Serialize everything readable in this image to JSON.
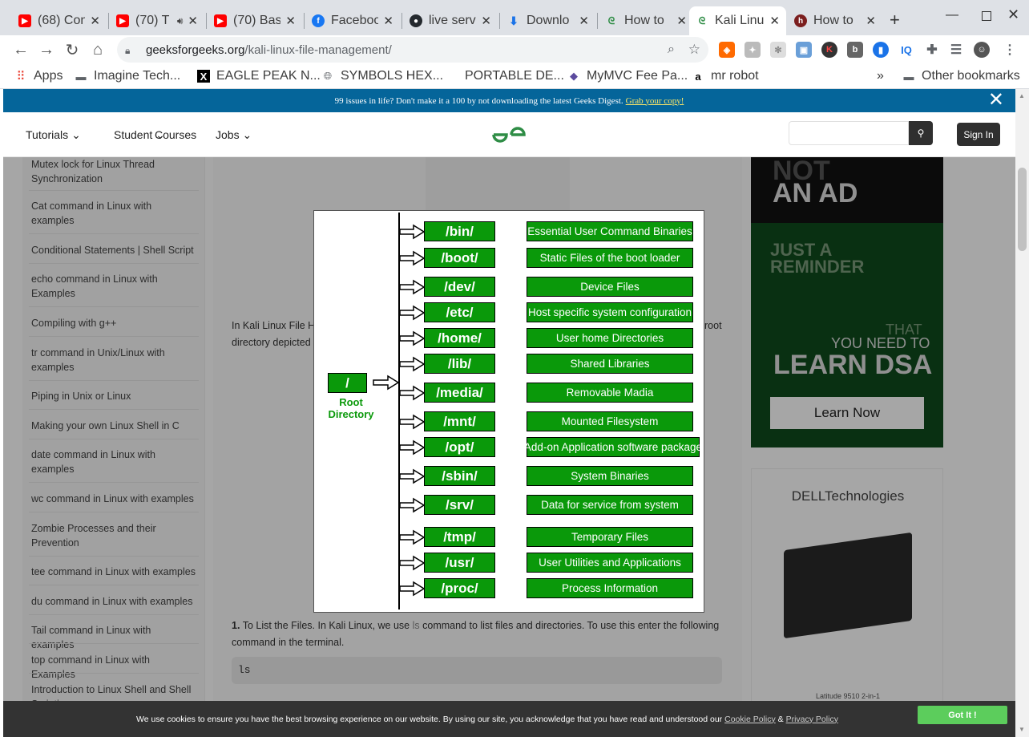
{
  "tabs": [
    {
      "title": "(68) Con",
      "icon": "youtube"
    },
    {
      "title": "(70) T",
      "icon": "youtube"
    },
    {
      "title": "(70) Bas",
      "icon": "youtube"
    },
    {
      "title": "Faceboo",
      "icon": "facebook"
    },
    {
      "title": "live serv",
      "icon": "github"
    },
    {
      "title": "Downlo",
      "icon": "download"
    },
    {
      "title": "How to",
      "icon": "gfg"
    },
    {
      "title": "Kali Linu",
      "icon": "gfg"
    },
    {
      "title": "How to",
      "icon": "hashnode"
    }
  ],
  "url": {
    "host": "geeksforgeeks.org",
    "path": "/kali-linux-file-management/"
  },
  "bookmarks": [
    {
      "label": "Apps"
    },
    {
      "label": "Imagine Tech..."
    },
    {
      "label": "EAGLE PEAK N..."
    },
    {
      "label": "SYMBOLS HEX..."
    },
    {
      "label": "PORTABLE DE..."
    },
    {
      "label": "MyMVC Fee Pa..."
    },
    {
      "label": "mr robot"
    }
  ],
  "other_bookmarks": "Other bookmarks",
  "banner": {
    "text": "99 issues in life? Don't make it a 100 by not downloading the latest Geeks Digest.",
    "link": "Grab your copy!"
  },
  "nav": {
    "tutorials": "Tutorials",
    "student": "Student",
    "courses": "Courses",
    "jobs": "Jobs",
    "sign_in": "Sign In"
  },
  "sidebar": [
    "Mutex lock for Linux Thread Synchronization",
    "Cat command in Linux with examples",
    "Conditional Statements | Shell Script",
    "echo command in Linux with Examples",
    "Compiling with g++",
    "tr command in Unix/Linux with examples",
    "Piping in Unix or Linux",
    "Making your own Linux Shell in C",
    "date command in Linux with examples",
    "wc command in Linux with examples",
    "Zombie Processes and their Prevention",
    "tee command in Linux with examples",
    "du command in Linux with examples",
    "Tail command in Linux with examples",
    "top command in Linux with Examples",
    "Introduction to Linux Shell and Shell Scripting"
  ],
  "article": {
    "p1_left": "In Kali Linux File H",
    "p1_right": "root",
    "p2_left": "directory depicted",
    "step1_num": "1.",
    "step1_a": "To List the Files. In Kali Linux, we use",
    "step1_cmd": "ls",
    "step1_b": "command to list files and directories. To use this enter the following",
    "step1_c": "command in the terminal.",
    "code": "ls"
  },
  "ads": {
    "ad1_not": "NOT",
    "ad1_an_ad": "AN AD",
    "ad1_just": "JUST A",
    "ad1_reminder": "REMINDER",
    "ad1_that": "THAT",
    "ad1_you_need": "YOU NEED TO",
    "ad1_learn": "LEARN DSA",
    "ad1_button": "Learn Now",
    "ad2_brand": "DELLTechnologies",
    "ad2_caption": "Latitude 9510 2-in-1"
  },
  "diagram": {
    "root_label": "/",
    "root_caption_1": "Root",
    "root_caption_2": "Directory",
    "rows": [
      {
        "dir": "/bin/",
        "desc": "Essential User Command Binaries"
      },
      {
        "dir": "/boot/",
        "desc": "Static Files of the boot loader"
      },
      {
        "dir": "/dev/",
        "desc": "Device Files"
      },
      {
        "dir": "/etc/",
        "desc": "Host specific system configuration"
      },
      {
        "dir": "/home/",
        "desc": "User home Directories"
      },
      {
        "dir": "/lib/",
        "desc": "Shared Libraries"
      },
      {
        "dir": "/media/",
        "desc": "Removable Madia"
      },
      {
        "dir": "/mnt/",
        "desc": "Mounted Filesystem"
      },
      {
        "dir": "/opt/",
        "desc": "Add-on Application software package"
      },
      {
        "dir": "/sbin/",
        "desc": "System Binaries"
      },
      {
        "dir": "/srv/",
        "desc": "Data for service from system"
      },
      {
        "dir": "/tmp/",
        "desc": "Temporary Files"
      },
      {
        "dir": "/usr/",
        "desc": "User Utilities and Applications"
      },
      {
        "dir": "/proc/",
        "desc": "Process Information"
      }
    ]
  },
  "cookie": {
    "text": "We use cookies to ensure you have the best browsing experience on our website. By using our site, you acknowledge that you have read and understood our",
    "cookie_policy": "Cookie Policy",
    "amp": "&",
    "privacy": "Privacy Policy",
    "button": "Got It !"
  },
  "colors": {
    "gfg_green": "#2f8d46",
    "diagram_green": "#0a990a",
    "banner_blue": "#05659a"
  }
}
